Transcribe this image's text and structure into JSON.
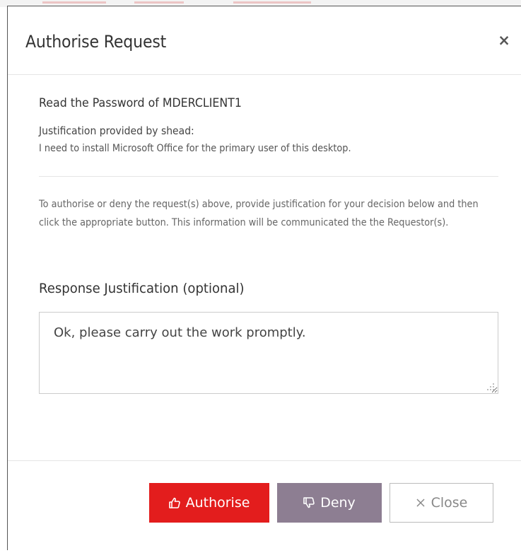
{
  "dialog": {
    "title": "Authorise Request",
    "close_glyph": "×"
  },
  "request": {
    "title": "Read the Password of MDERCLIENT1",
    "justification_label": "Justification provided by shead:",
    "justification_text": "I need to install Microsoft Office for the primary user of this desktop."
  },
  "instructions": {
    "text": "To authorise or deny the request(s) above, provide justification for your decision below and then click the appropriate button. This information will be communicated the the Requestor(s)."
  },
  "response": {
    "label": "Response Justification (optional)",
    "value": "Ok, please carry out the work promptly."
  },
  "buttons": {
    "authorise": {
      "label": "Authorise",
      "icon": "thumbs-up-icon",
      "color": "#e31d1d"
    },
    "deny": {
      "label": "Deny",
      "icon": "thumbs-down-icon",
      "color": "#8d7e92"
    },
    "close": {
      "label": "Close",
      "icon": "close-icon"
    }
  }
}
